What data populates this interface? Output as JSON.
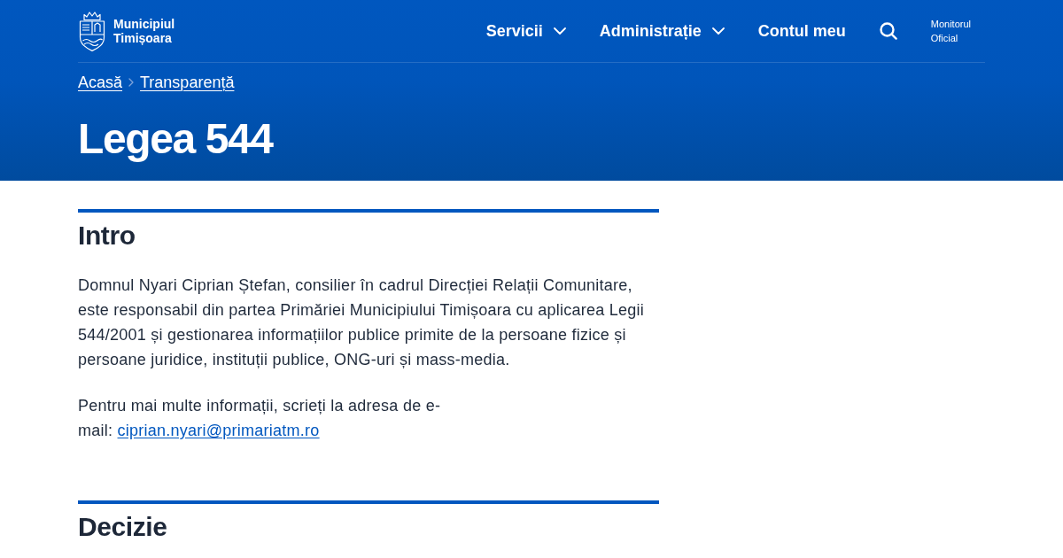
{
  "header": {
    "site_name": "Municipiul Timișoara",
    "nav": [
      {
        "label": "Servicii",
        "kind": "dropdown"
      },
      {
        "label": "Administrație",
        "kind": "dropdown"
      },
      {
        "label": "Contul meu",
        "kind": "link"
      }
    ],
    "secondary_link": "Monitorul Oficial"
  },
  "breadcrumb": [
    "Acasă",
    "Transparență"
  ],
  "page_title": "Legea 544",
  "sections": [
    {
      "heading": "Intro",
      "paragraphs": [
        {
          "text": "Domnul Nyari Ciprian Ștefan, consilier în cadrul Direcției Relații Comunitare, este responsabil din partea Primăriei Municipiului Timișoara cu aplicarea Legii 544/2001 și gestionarea informațiilor publice primite de la persoane fizice și persoane juridice, instituții publice, ONG-uri și mass-media."
        },
        {
          "text": "Pentru mai multe informații, scrieți la adresa de e-mail:",
          "link": "ciprian.nyari@primariatm.ro"
        }
      ]
    },
    {
      "heading": "Decizie"
    }
  ]
}
